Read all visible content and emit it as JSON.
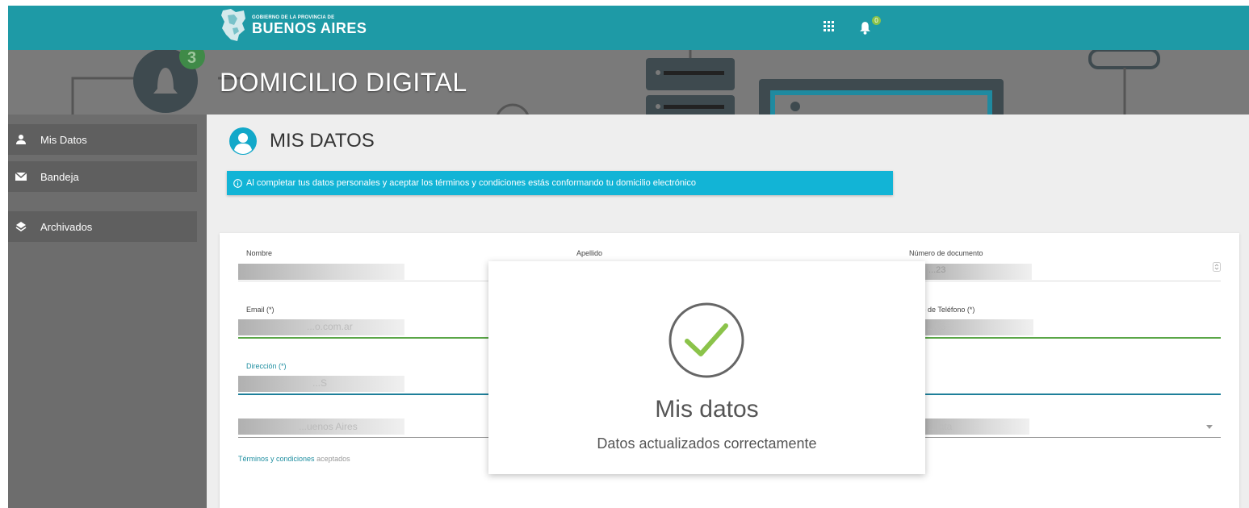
{
  "header": {
    "logo_small": "GOBIERNO DE LA PROVINCIA DE",
    "logo_big": "BUENOS AIRES",
    "notification_count": "0",
    "brand_color": "#1e9aa6"
  },
  "banner": {
    "title": "DOMICILIO DIGITAL",
    "badge_number": "3"
  },
  "sidebar": {
    "items": [
      {
        "label": "Mis Datos",
        "icon": "user-icon"
      },
      {
        "label": "Bandeja",
        "icon": "envelope-icon"
      },
      {
        "label": "Archivados",
        "icon": "layers-icon"
      }
    ]
  },
  "main": {
    "title": "MIS DATOS",
    "info": "Al completar tus datos personales y aceptar los términos y condiciones estás conformando tu domicilio electrónico",
    "fields": {
      "nombre": {
        "label": "Nombre"
      },
      "apellido": {
        "label": "Apellido"
      },
      "documento": {
        "label": "Número de documento",
        "value": "...23"
      },
      "email": {
        "label": "Email (*)",
        "value": "...o.com.ar"
      },
      "telefono": {
        "label": "...ero de Teléfono (*)",
        "value": "...05"
      },
      "direccion": {
        "label": "Dirección (*)",
        "value": "...S"
      },
      "provincia": {
        "value": "...uenos Aires"
      },
      "localidad": {
        "value": "...lata"
      }
    },
    "terms_link": "Términos y condiciones",
    "terms_text": "aceptados"
  },
  "modal": {
    "title": "Mis datos",
    "message": "Datos actualizados correctamente",
    "check_color": "#8bc34a"
  }
}
